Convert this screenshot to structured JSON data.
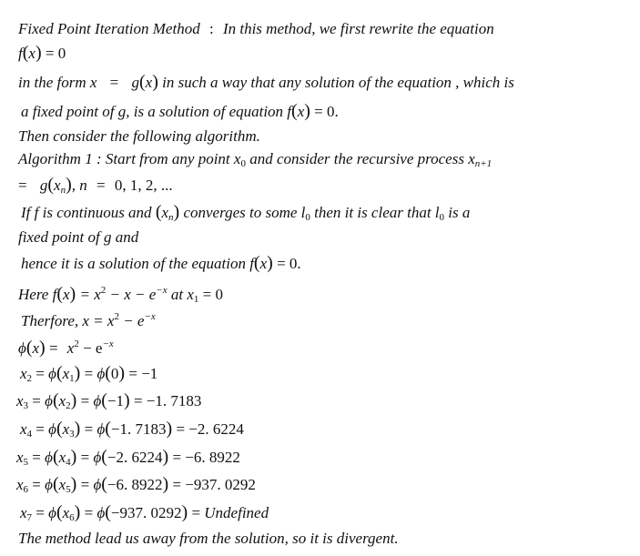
{
  "document": {
    "intro": {
      "heading": "Fixed Point Iteration Method",
      "colon": ":",
      "text": "In this method, we first rewrite the equation"
    },
    "equation_f": {
      "lhs_fn": "f",
      "lhs_arg": "x",
      "rhs": "= 0"
    },
    "form_line": {
      "prefix": "in the form x",
      "eq": "=",
      "g": "g",
      "arg": "x",
      "suffix": "in such a way that any solution of the equation , which is"
    },
    "fixed_point_line": {
      "prefix": "a fixed point of g,",
      "mid": "is a solution of equation f",
      "arg": "x",
      "suffix": "= 0."
    },
    "then_line": "Then consider the following algorithm.",
    "algorithm": {
      "label": "Algorithm 1 :",
      "text": "Start from any point x",
      "sub0": "0",
      "text2": "and consider the recursive process x",
      "sub_np1": "n+1"
    },
    "recursion": {
      "eq": "=",
      "g": "g",
      "arg": "x",
      "arg_sub": "n",
      "n_part": ", n",
      "n_eq": "=",
      "values": "0, 1, 2, ..."
    },
    "converge_line": {
      "prefix": "If f is continuous and",
      "arg": "x",
      "arg_sub": "n",
      "mid": "converges to some l",
      "sub": "0",
      "mid2": "then it is clear that l",
      "sub2": "0",
      "suffix": "is a"
    },
    "fixed_line": "fixed point of g and",
    "hence_line": {
      "prefix": "hence it is a solution of the equation f",
      "arg": "x",
      "suffix": "= 0."
    },
    "here_line": {
      "prefix": "Here f",
      "arg": "x",
      "eq": "= x",
      "sq": "2",
      "rest": " − x − e",
      "exp": "−x",
      "at": "at x",
      "sub1": "1",
      "val": "= 0"
    },
    "therefore_line": {
      "prefix": "Therfore, x =",
      "x2": "x",
      "sq": "2",
      "rest": " − e",
      "exp": "−x"
    },
    "phi_line": {
      "phi": "ϕ",
      "arg": "x",
      "eq": "=",
      "x2": "x",
      "sq": "2",
      "rest": " − e",
      "exp": "−x"
    },
    "iterations": [
      {
        "lhs": "x",
        "lhs_sub": "2",
        "arg": "x",
        "arg_sub": "1",
        "input": "0",
        "result": "−1",
        "result_italic": false
      },
      {
        "lhs": "x",
        "lhs_sub": "3",
        "arg": "x",
        "arg_sub": "2",
        "input": "−1",
        "result": "−1. 7183",
        "result_italic": false
      },
      {
        "lhs": "x",
        "lhs_sub": "4",
        "arg": "x",
        "arg_sub": "3",
        "input": "−1. 7183",
        "result": "−2. 6224",
        "result_italic": false
      },
      {
        "lhs": "x",
        "lhs_sub": "5",
        "arg": "x",
        "arg_sub": "4",
        "input": "−2. 6224",
        "result": "−6. 8922",
        "result_italic": false
      },
      {
        "lhs": "x",
        "lhs_sub": "6",
        "arg": "x",
        "arg_sub": "5",
        "input": "−6. 8922",
        "result": "−937. 0292",
        "result_italic": false
      },
      {
        "lhs": "x",
        "lhs_sub": "7",
        "arg": "x",
        "arg_sub": "6",
        "input": "−937. 0292",
        "result": "Undefined",
        "result_italic": true
      }
    ],
    "phi_symbol": "ϕ",
    "eq_sign": "=",
    "conclusion": "The method lead us away from the solution,  so it is divergent."
  }
}
